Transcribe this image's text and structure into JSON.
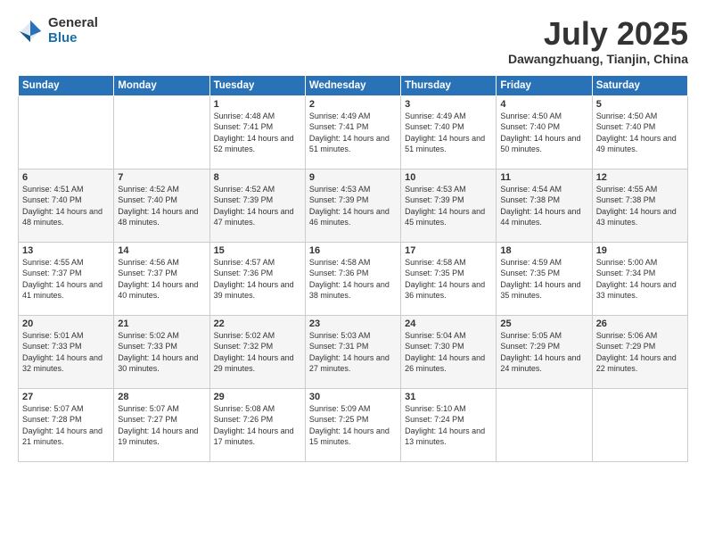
{
  "logo": {
    "general": "General",
    "blue": "Blue"
  },
  "header": {
    "month": "July 2025",
    "location": "Dawangzhuang, Tianjin, China"
  },
  "weekdays": [
    "Sunday",
    "Monday",
    "Tuesday",
    "Wednesday",
    "Thursday",
    "Friday",
    "Saturday"
  ],
  "weeks": [
    [
      {
        "day": "",
        "sunrise": "",
        "sunset": "",
        "daylight": ""
      },
      {
        "day": "",
        "sunrise": "",
        "sunset": "",
        "daylight": ""
      },
      {
        "day": "1",
        "sunrise": "Sunrise: 4:48 AM",
        "sunset": "Sunset: 7:41 PM",
        "daylight": "Daylight: 14 hours and 52 minutes."
      },
      {
        "day": "2",
        "sunrise": "Sunrise: 4:49 AM",
        "sunset": "Sunset: 7:41 PM",
        "daylight": "Daylight: 14 hours and 51 minutes."
      },
      {
        "day": "3",
        "sunrise": "Sunrise: 4:49 AM",
        "sunset": "Sunset: 7:40 PM",
        "daylight": "Daylight: 14 hours and 51 minutes."
      },
      {
        "day": "4",
        "sunrise": "Sunrise: 4:50 AM",
        "sunset": "Sunset: 7:40 PM",
        "daylight": "Daylight: 14 hours and 50 minutes."
      },
      {
        "day": "5",
        "sunrise": "Sunrise: 4:50 AM",
        "sunset": "Sunset: 7:40 PM",
        "daylight": "Daylight: 14 hours and 49 minutes."
      }
    ],
    [
      {
        "day": "6",
        "sunrise": "Sunrise: 4:51 AM",
        "sunset": "Sunset: 7:40 PM",
        "daylight": "Daylight: 14 hours and 48 minutes."
      },
      {
        "day": "7",
        "sunrise": "Sunrise: 4:52 AM",
        "sunset": "Sunset: 7:40 PM",
        "daylight": "Daylight: 14 hours and 48 minutes."
      },
      {
        "day": "8",
        "sunrise": "Sunrise: 4:52 AM",
        "sunset": "Sunset: 7:39 PM",
        "daylight": "Daylight: 14 hours and 47 minutes."
      },
      {
        "day": "9",
        "sunrise": "Sunrise: 4:53 AM",
        "sunset": "Sunset: 7:39 PM",
        "daylight": "Daylight: 14 hours and 46 minutes."
      },
      {
        "day": "10",
        "sunrise": "Sunrise: 4:53 AM",
        "sunset": "Sunset: 7:39 PM",
        "daylight": "Daylight: 14 hours and 45 minutes."
      },
      {
        "day": "11",
        "sunrise": "Sunrise: 4:54 AM",
        "sunset": "Sunset: 7:38 PM",
        "daylight": "Daylight: 14 hours and 44 minutes."
      },
      {
        "day": "12",
        "sunrise": "Sunrise: 4:55 AM",
        "sunset": "Sunset: 7:38 PM",
        "daylight": "Daylight: 14 hours and 43 minutes."
      }
    ],
    [
      {
        "day": "13",
        "sunrise": "Sunrise: 4:55 AM",
        "sunset": "Sunset: 7:37 PM",
        "daylight": "Daylight: 14 hours and 41 minutes."
      },
      {
        "day": "14",
        "sunrise": "Sunrise: 4:56 AM",
        "sunset": "Sunset: 7:37 PM",
        "daylight": "Daylight: 14 hours and 40 minutes."
      },
      {
        "day": "15",
        "sunrise": "Sunrise: 4:57 AM",
        "sunset": "Sunset: 7:36 PM",
        "daylight": "Daylight: 14 hours and 39 minutes."
      },
      {
        "day": "16",
        "sunrise": "Sunrise: 4:58 AM",
        "sunset": "Sunset: 7:36 PM",
        "daylight": "Daylight: 14 hours and 38 minutes."
      },
      {
        "day": "17",
        "sunrise": "Sunrise: 4:58 AM",
        "sunset": "Sunset: 7:35 PM",
        "daylight": "Daylight: 14 hours and 36 minutes."
      },
      {
        "day": "18",
        "sunrise": "Sunrise: 4:59 AM",
        "sunset": "Sunset: 7:35 PM",
        "daylight": "Daylight: 14 hours and 35 minutes."
      },
      {
        "day": "19",
        "sunrise": "Sunrise: 5:00 AM",
        "sunset": "Sunset: 7:34 PM",
        "daylight": "Daylight: 14 hours and 33 minutes."
      }
    ],
    [
      {
        "day": "20",
        "sunrise": "Sunrise: 5:01 AM",
        "sunset": "Sunset: 7:33 PM",
        "daylight": "Daylight: 14 hours and 32 minutes."
      },
      {
        "day": "21",
        "sunrise": "Sunrise: 5:02 AM",
        "sunset": "Sunset: 7:33 PM",
        "daylight": "Daylight: 14 hours and 30 minutes."
      },
      {
        "day": "22",
        "sunrise": "Sunrise: 5:02 AM",
        "sunset": "Sunset: 7:32 PM",
        "daylight": "Daylight: 14 hours and 29 minutes."
      },
      {
        "day": "23",
        "sunrise": "Sunrise: 5:03 AM",
        "sunset": "Sunset: 7:31 PM",
        "daylight": "Daylight: 14 hours and 27 minutes."
      },
      {
        "day": "24",
        "sunrise": "Sunrise: 5:04 AM",
        "sunset": "Sunset: 7:30 PM",
        "daylight": "Daylight: 14 hours and 26 minutes."
      },
      {
        "day": "25",
        "sunrise": "Sunrise: 5:05 AM",
        "sunset": "Sunset: 7:29 PM",
        "daylight": "Daylight: 14 hours and 24 minutes."
      },
      {
        "day": "26",
        "sunrise": "Sunrise: 5:06 AM",
        "sunset": "Sunset: 7:29 PM",
        "daylight": "Daylight: 14 hours and 22 minutes."
      }
    ],
    [
      {
        "day": "27",
        "sunrise": "Sunrise: 5:07 AM",
        "sunset": "Sunset: 7:28 PM",
        "daylight": "Daylight: 14 hours and 21 minutes."
      },
      {
        "day": "28",
        "sunrise": "Sunrise: 5:07 AM",
        "sunset": "Sunset: 7:27 PM",
        "daylight": "Daylight: 14 hours and 19 minutes."
      },
      {
        "day": "29",
        "sunrise": "Sunrise: 5:08 AM",
        "sunset": "Sunset: 7:26 PM",
        "daylight": "Daylight: 14 hours and 17 minutes."
      },
      {
        "day": "30",
        "sunrise": "Sunrise: 5:09 AM",
        "sunset": "Sunset: 7:25 PM",
        "daylight": "Daylight: 14 hours and 15 minutes."
      },
      {
        "day": "31",
        "sunrise": "Sunrise: 5:10 AM",
        "sunset": "Sunset: 7:24 PM",
        "daylight": "Daylight: 14 hours and 13 minutes."
      },
      {
        "day": "",
        "sunrise": "",
        "sunset": "",
        "daylight": ""
      },
      {
        "day": "",
        "sunrise": "",
        "sunset": "",
        "daylight": ""
      }
    ]
  ]
}
